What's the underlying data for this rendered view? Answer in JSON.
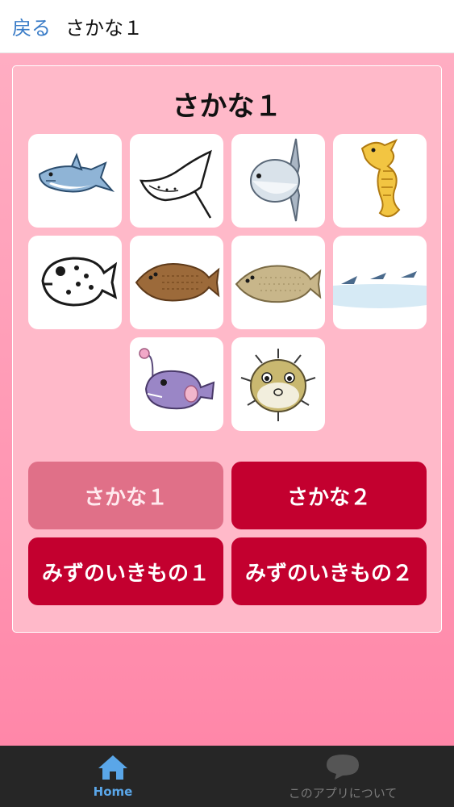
{
  "topbar": {
    "back_label": "戻る",
    "title": "さかな１"
  },
  "panel": {
    "title": "さかな１"
  },
  "tiles": [
    {
      "icon": "shark-icon"
    },
    {
      "icon": "manta-ray-icon"
    },
    {
      "icon": "sunfish-icon"
    },
    {
      "icon": "seahorse-icon"
    },
    {
      "icon": "pufferfish-icon"
    },
    {
      "icon": "flounder-icon"
    },
    {
      "icon": "halibut-icon"
    },
    {
      "icon": "flying-fish-icon"
    },
    {
      "icon": "anglerfish-icon"
    },
    {
      "icon": "porcupinefish-icon"
    }
  ],
  "categories": [
    {
      "label": "さかな１",
      "active": true
    },
    {
      "label": "さかな２",
      "active": false
    },
    {
      "label": "みずのいきもの１",
      "active": false
    },
    {
      "label": "みずのいきもの２",
      "active": false
    }
  ],
  "bottom_nav": {
    "home_label": "Home",
    "about_label": "このアプリについて"
  },
  "colors": {
    "accent": "#c3002f",
    "active_category": "#e07088",
    "link": "#3a7cc7",
    "nav_active": "#5aa6e8"
  }
}
